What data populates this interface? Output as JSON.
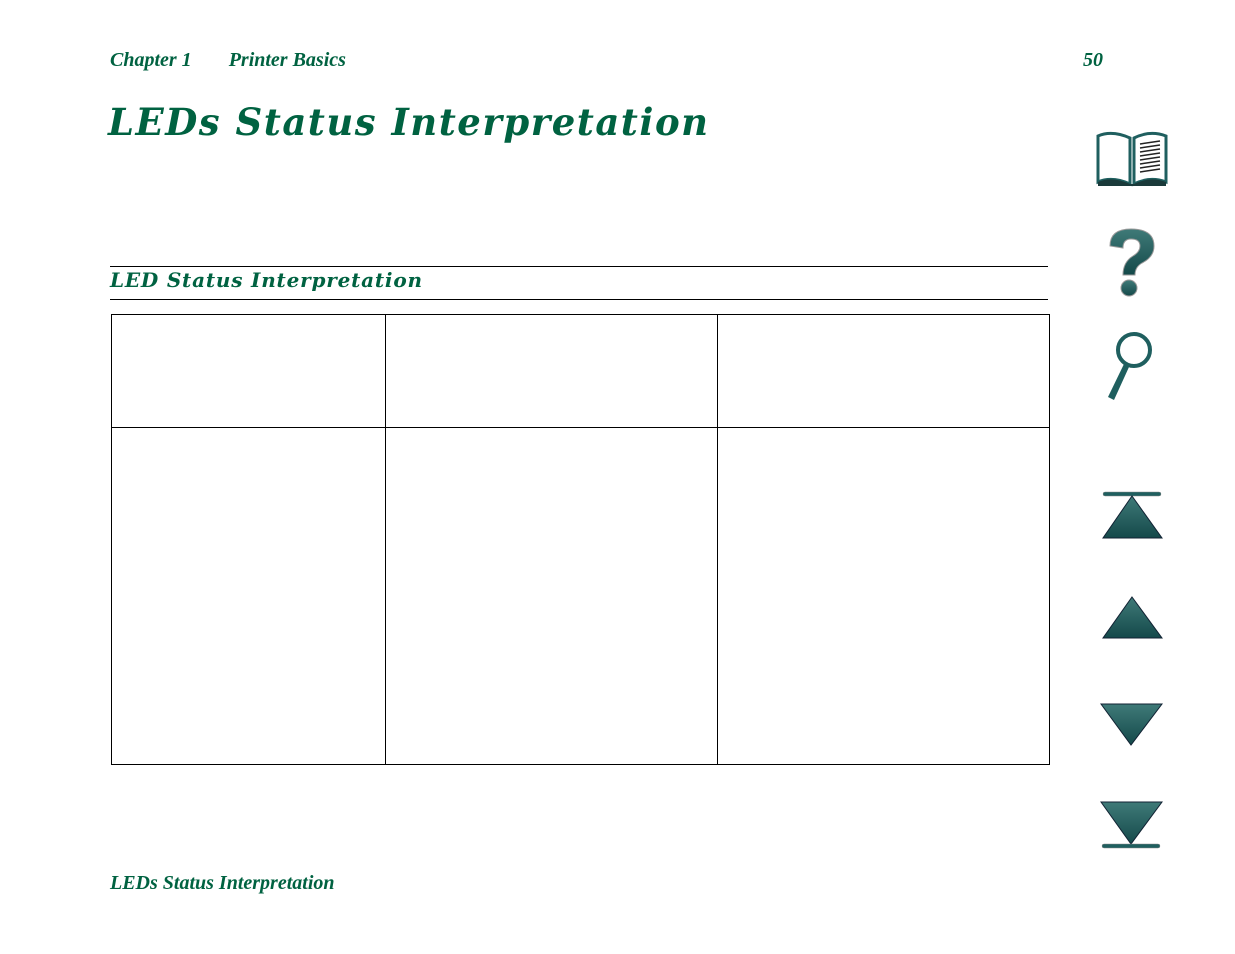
{
  "header": {
    "chapter": "Chapter 1",
    "chapter_title": "Printer Basics",
    "page_number": "50"
  },
  "page_title": "LEDs Status Interpretation",
  "section": {
    "title": "LED Status Interpretation"
  },
  "table": {
    "rows": [
      [
        "",
        "",
        ""
      ],
      [
        "",
        "",
        ""
      ]
    ]
  },
  "footer": {
    "text": "LEDs Status Interpretation"
  },
  "nav_icons": [
    {
      "name": "contents-book-icon"
    },
    {
      "name": "help-question-icon"
    },
    {
      "name": "search-magnifier-icon"
    },
    {
      "name": "first-page-icon"
    },
    {
      "name": "previous-page-icon"
    },
    {
      "name": "next-page-icon"
    },
    {
      "name": "last-page-icon"
    }
  ],
  "colors": {
    "text": "#006241",
    "icon": "#1f5f5f",
    "rule": "#000000"
  }
}
